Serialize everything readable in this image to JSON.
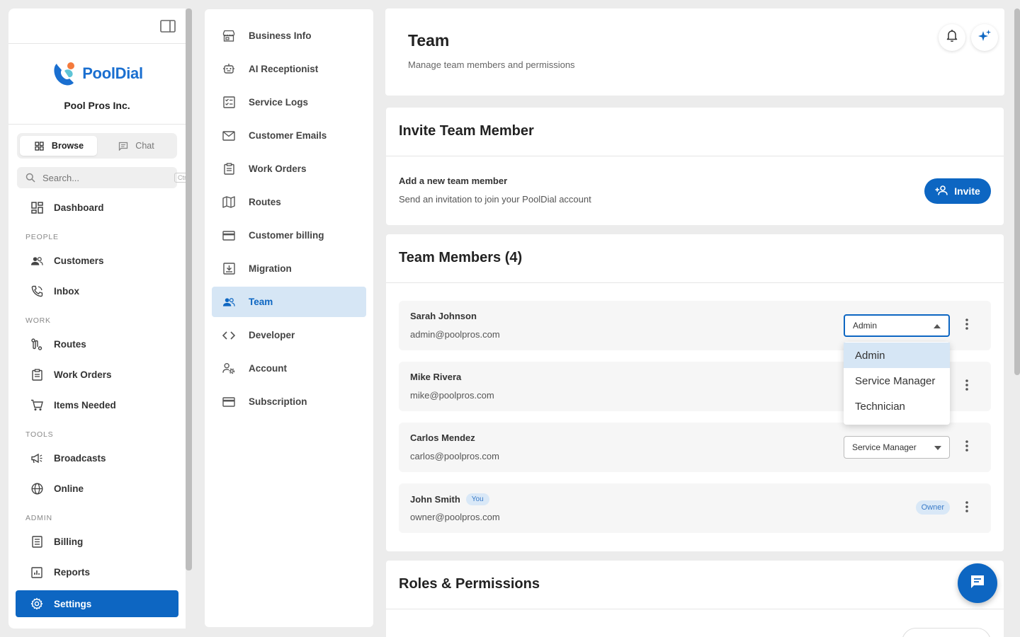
{
  "brand": {
    "logo_text": "PoolDial",
    "company": "Pool Pros Inc."
  },
  "sidebar": {
    "seg": {
      "browse": "Browse",
      "chat": "Chat"
    },
    "search": {
      "placeholder": "Search...",
      "shortcut": "Ctrl+K"
    },
    "dashboard": "Dashboard",
    "sections": {
      "people": "PEOPLE",
      "work": "WORK",
      "tools": "TOOLS",
      "admin": "ADMIN"
    },
    "items": {
      "customers": "Customers",
      "inbox": "Inbox",
      "routes": "Routes",
      "work_orders": "Work Orders",
      "items_needed": "Items Needed",
      "broadcasts": "Broadcasts",
      "online": "Online",
      "billing": "Billing",
      "reports": "Reports",
      "settings": "Settings"
    }
  },
  "settings_nav": {
    "business_info": "Business Info",
    "ai_receptionist": "AI Receptionist",
    "service_logs": "Service Logs",
    "customer_emails": "Customer Emails",
    "work_orders": "Work Orders",
    "routes": "Routes",
    "customer_billing": "Customer billing",
    "migration": "Migration",
    "team": "Team",
    "developer": "Developer",
    "account": "Account",
    "subscription": "Subscription"
  },
  "header": {
    "title": "Team",
    "subtitle": "Manage team members and permissions"
  },
  "invite": {
    "title": "Invite Team Member",
    "label": "Add a new team member",
    "description": "Send an invitation to join your PoolDial account",
    "button": "Invite"
  },
  "members": {
    "title": "Team Members (4)",
    "rows": [
      {
        "name": "Sarah Johnson",
        "email": "admin@poolpros.com",
        "role": "Admin"
      },
      {
        "name": "Mike Rivera",
        "email": "mike@poolpros.com"
      },
      {
        "name": "Carlos Mendez",
        "email": "carlos@poolpros.com",
        "role": "Service Manager"
      },
      {
        "name": "John Smith",
        "you": "You",
        "email": "owner@poolpros.com",
        "badge": "Owner"
      }
    ],
    "dropdown_options": [
      "Admin",
      "Service Manager",
      "Technician"
    ]
  },
  "roles": {
    "title": "Roles & Permissions"
  },
  "colors": {
    "accent": "#0d66c2",
    "accent_light": "#d6e6f5"
  }
}
